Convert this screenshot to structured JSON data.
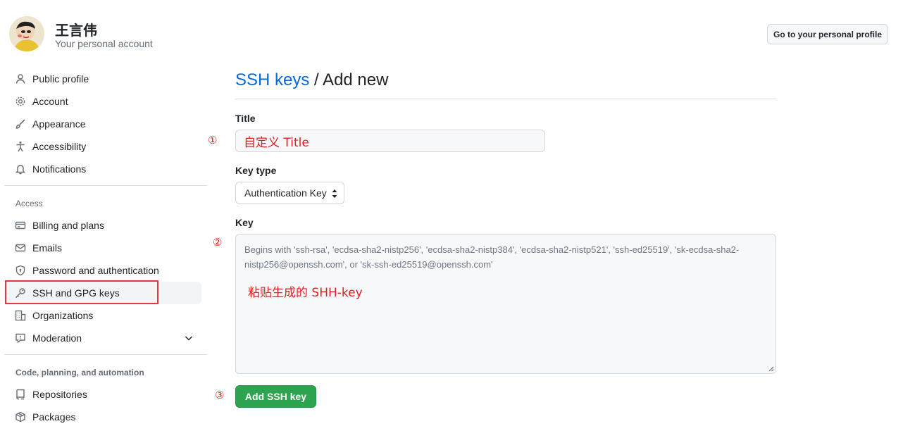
{
  "header": {
    "user_name": "王言伟",
    "account_subtitle": "Your personal account",
    "profile_button": "Go to your personal profile"
  },
  "sidebar": {
    "items_top": [
      {
        "label": "Public profile",
        "icon": "person-icon"
      },
      {
        "label": "Account",
        "icon": "gear-icon"
      },
      {
        "label": "Appearance",
        "icon": "paintbrush-icon"
      },
      {
        "label": "Accessibility",
        "icon": "accessibility-icon"
      },
      {
        "label": "Notifications",
        "icon": "bell-icon"
      }
    ],
    "access_label": "Access",
    "items_access": [
      {
        "label": "Billing and plans",
        "icon": "credit-card-icon"
      },
      {
        "label": "Emails",
        "icon": "mail-icon"
      },
      {
        "label": "Password and authentication",
        "icon": "shield-icon"
      },
      {
        "label": "SSH and GPG keys",
        "icon": "key-icon",
        "active": true
      },
      {
        "label": "Organizations",
        "icon": "organization-icon"
      },
      {
        "label": "Moderation",
        "icon": "report-icon"
      }
    ],
    "code_label": "Code, planning, and automation",
    "items_code": [
      {
        "label": "Repositories",
        "icon": "repo-icon"
      },
      {
        "label": "Packages",
        "icon": "package-icon"
      }
    ]
  },
  "main": {
    "breadcrumb_link": "SSH keys",
    "breadcrumb_current": "/ Add new",
    "title_label": "Title",
    "title_value": "自定义 Title",
    "key_type_label": "Key type",
    "key_type_value": "Authentication Key",
    "key_label": "Key",
    "key_placeholder": "Begins with 'ssh-rsa', 'ecdsa-sha2-nistp256', 'ecdsa-sha2-nistp384', 'ecdsa-sha2-nistp521', 'ssh-ed25519', 'sk-ecdsa-sha2-nistp256@openssh.com', or 'sk-ssh-ed25519@openssh.com'",
    "key_annotation": "粘贴生成的 SHH-key",
    "submit_label": "Add SSH key"
  },
  "annotations": {
    "marker_1": "①",
    "marker_2": "②",
    "marker_3": "③"
  },
  "colors": {
    "link": "#0969da",
    "primary_button": "#2da44e",
    "annotation_red": "#e02020"
  }
}
